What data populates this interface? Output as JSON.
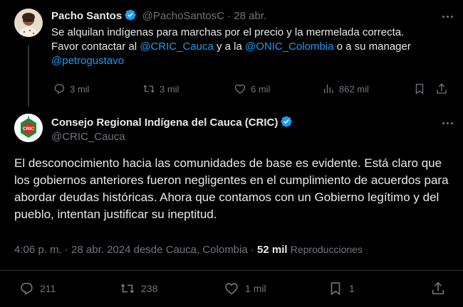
{
  "tweet1": {
    "name": "Pacho Santos",
    "handle": "@PachoSantosC",
    "date": "28 abr.",
    "text_part1": "Se alquilan indígenas para marchas por el precio y la mermelada correcta.",
    "text_part2": "Favor contactar al ",
    "mention1": "@CRIC_Cauca",
    "text_part3": " y a la ",
    "mention2": "@ONIC_Colombia",
    "text_part4": " o a su manager",
    "mention3": "@petrogustavo",
    "replies": "3 mil",
    "reposts": "3 mil",
    "likes": "6 mil",
    "views": "862 mil"
  },
  "tweet2": {
    "name": "Consejo Regional Indígena del Cauca (CRIC)",
    "handle": "@CRIC_Cauca",
    "text": "El desconocimiento hacia las comunidades de base es evidente. Está claro que los gobiernos anteriores fueron negligentes en el cumplimiento de acuerdos para abordar deudas históricas. Ahora que contamos con un Gobierno legítimo y del pueblo, intentan justificar su ineptitud.",
    "timestamp": "4:06 p. m. · 28 abr. 2024 desde Cauca, Colombia ·",
    "views_count": "52 mil",
    "views_label": "Reproducciones",
    "replies": "211",
    "reposts": "238",
    "likes": "1 mil",
    "bookmarks": "1"
  },
  "colors": {
    "background": "#000000",
    "text": "#e7e9ea",
    "muted": "#71767b",
    "link": "#1d9bf0",
    "verified": "#1d9bf0"
  }
}
